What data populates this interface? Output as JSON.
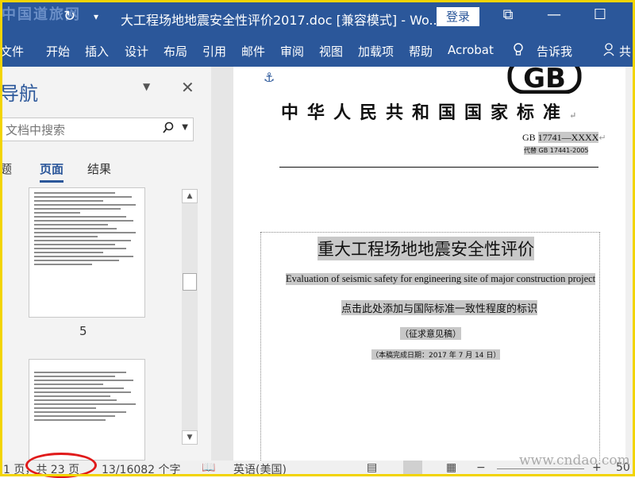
{
  "titlebar": {
    "watermark": "中国道旅网",
    "refresh_icon": "↻",
    "qa_icon": "▾",
    "doc_title": "大工程场地地震安全性评价2017.doc [兼容模式] - Wo...",
    "login_label": "登录",
    "restore_icon": "⧉",
    "minimize_icon": "—",
    "maximize_icon": "☐"
  },
  "ribbon": {
    "tabs": [
      "文件",
      "开始",
      "插入",
      "设计",
      "布局",
      "引用",
      "邮件",
      "审阅",
      "视图",
      "加载项",
      "帮助",
      "Acrobat",
      "告诉我",
      "共"
    ]
  },
  "nav": {
    "title": "导航",
    "search_placeholder": "文档中搜索",
    "tabs": [
      "题",
      "页面",
      "结果"
    ],
    "page_number": "5"
  },
  "doc": {
    "national_standard": "中华人民共和国国家标准",
    "gb_number_prefix": "GB ",
    "gb_number": "17741—XXXX",
    "replace": "代替 GB 17441-2005",
    "main_title": "重大工程场地地震安全性评价",
    "english_title": "Evaluation of seismic safety for engineering site of major construction project",
    "standard_marker": "点击此处添加与国际标准一致性程度的标识",
    "draft_label": "（征求意见稿）",
    "date_label": "（本稿完成日期：2017 年 7 月 14 日）"
  },
  "status": {
    "page": "1 页，共 23 页",
    "words": "13/16082 个字",
    "language": "英语(美国)",
    "zoom": "50",
    "watermark": "www.cndao.com"
  },
  "colors": {
    "ribbon": "#2b579a",
    "frame": "#f2d400",
    "circle": "#e01a1a"
  }
}
